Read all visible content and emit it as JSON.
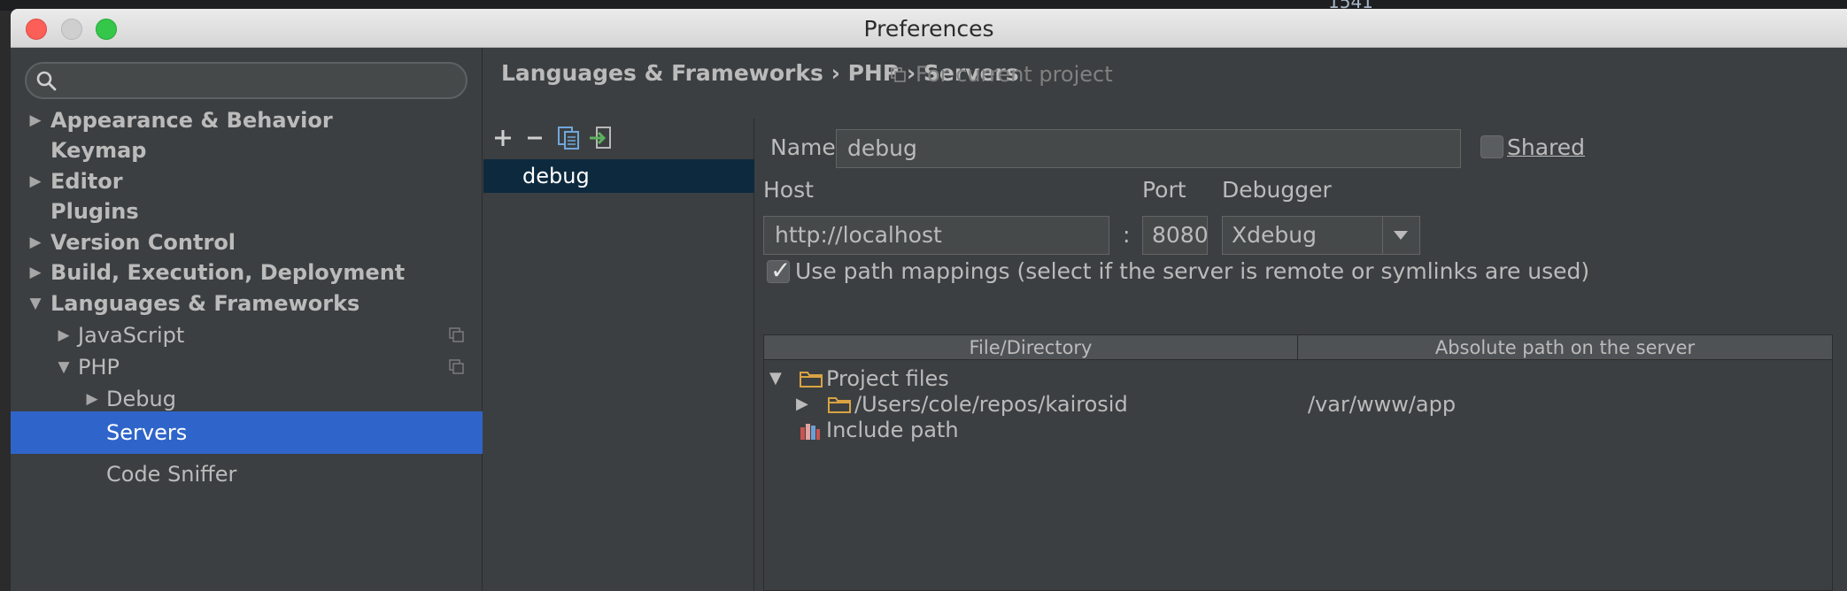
{
  "window": {
    "title": "Preferences"
  },
  "background_window": {
    "count": "1541"
  },
  "sidebar": {
    "search_placeholder": "",
    "items": [
      {
        "label": "Appearance & Behavior",
        "arrow": "▶"
      },
      {
        "label": "Keymap",
        "arrow": ""
      },
      {
        "label": "Editor",
        "arrow": "▶"
      },
      {
        "label": "Plugins",
        "arrow": ""
      },
      {
        "label": "Version Control",
        "arrow": "▶"
      },
      {
        "label": "Build, Execution, Deployment",
        "arrow": "▶"
      },
      {
        "label": "Languages & Frameworks",
        "arrow": "▼"
      },
      {
        "label": "JavaScript",
        "arrow": "▶"
      },
      {
        "label": "PHP",
        "arrow": "▼"
      },
      {
        "label": "Debug",
        "arrow": "▶"
      },
      {
        "label": "Servers",
        "arrow": ""
      },
      {
        "label": "Code Sniffer",
        "arrow": ""
      }
    ]
  },
  "header": {
    "breadcrumb": "Languages & Frameworks › PHP › Servers",
    "scope": "For current project"
  },
  "servers": {
    "toolbar": {
      "add": "+",
      "remove": "−"
    },
    "items": [
      {
        "label": "debug"
      }
    ]
  },
  "form": {
    "name_label": "Name:",
    "name_value": "debug",
    "shared_label": "Shared",
    "host_label": "Host",
    "host_value": "http://localhost",
    "colon": ":",
    "port_label": "Port",
    "port_value": "8080",
    "debugger_label": "Debugger",
    "debugger_value": "Xdebug",
    "path_mappings_label": "Use path mappings (select if the server is remote or symlinks are used)",
    "path_mappings_checked": true
  },
  "mappings_table": {
    "columns": [
      "File/Directory",
      "Absolute path on the server"
    ],
    "rows": [
      {
        "label": "Project files",
        "server_path": ""
      },
      {
        "label": "/Users/cole/repos/kairosid",
        "server_path": "/var/www/app"
      },
      {
        "label": "Include path",
        "server_path": ""
      }
    ]
  },
  "colors": {
    "selection": "#2f65ca",
    "list_selection": "#0d293e",
    "panel": "#3c3f41",
    "folder": "#d9a343"
  }
}
